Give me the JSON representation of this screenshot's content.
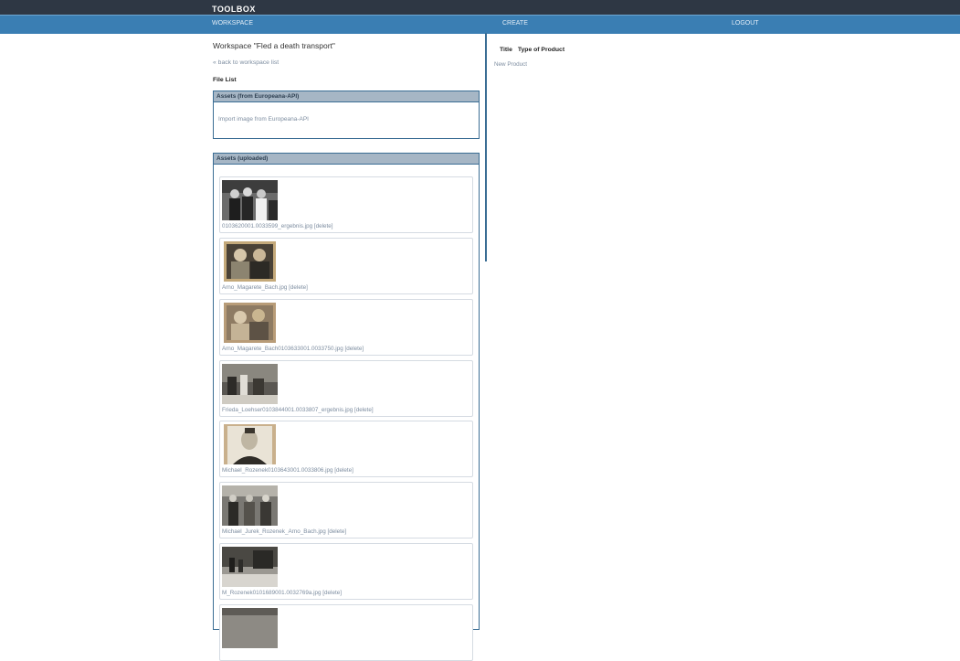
{
  "header": {
    "brand": "TOOLBOX"
  },
  "nav": {
    "workspace": "WORKSPACE",
    "create": "CREATE",
    "logout": "LOGOUT"
  },
  "workspace": {
    "title": "Workspace \"Fled a death transport\"",
    "back_link": "« back to workspace list",
    "file_list_label": "File List"
  },
  "europeana_box": {
    "title": "Assets (from Europeana-API)",
    "import_link": "Import image from Europeana-API"
  },
  "uploaded_box": {
    "title": "Assets (uploaded)",
    "delete_label": "[delete]",
    "assets": [
      {
        "filename": "0103620001.0033599_ergebnis.jpg"
      },
      {
        "filename": "Arno_Magarete_Bach.jpg"
      },
      {
        "filename": "Arno_Magarete_Bach0103633001.0033750.jpg"
      },
      {
        "filename": "Frieda_Loehser0103844001.0033807_ergebnis.jpg"
      },
      {
        "filename": "Michael_Rozenek0103643001.0033806.jpg"
      },
      {
        "filename": "Michael_Jurek_Rozenek_Arno_Bach.jpg"
      },
      {
        "filename": "M_Rozenek0101689001.0032769a.jpg"
      }
    ]
  },
  "products": {
    "col_title": "Title",
    "col_type": "Type of Product",
    "new_product_link": "New Product"
  },
  "colors": {
    "topbar": "#2e3744",
    "navbar": "#3a7eb3",
    "box_header": "#a6b6c5",
    "link": "#7d8da0"
  }
}
